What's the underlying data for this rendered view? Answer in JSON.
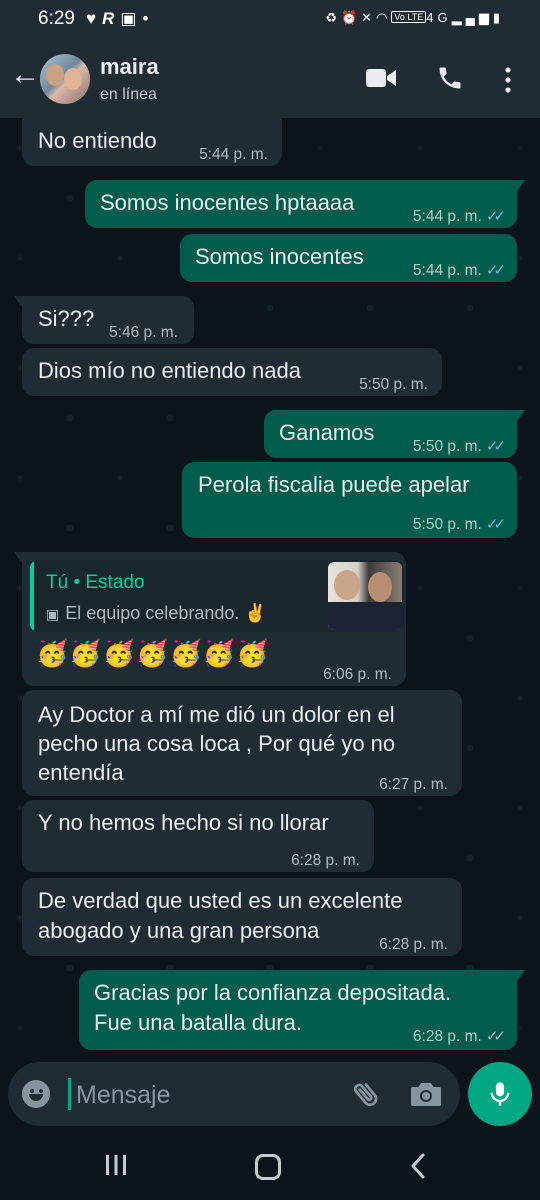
{
  "status_bar": {
    "time": "6:29",
    "left_icons": [
      "heart-icon",
      "r-app-icon",
      "gallery-icon",
      "dot-icon"
    ],
    "right_icons": [
      "battery-saver-icon",
      "alarm-icon",
      "mute-icon",
      "wifi-icon",
      "volte-icon",
      "signal-icon",
      "battery-icon"
    ],
    "network_badge": "VoLTE 4G",
    "network_type": "4G"
  },
  "header": {
    "contact_name": "maira",
    "contact_status": "en línea",
    "icons": [
      "back-arrow-icon",
      "video-call-icon",
      "voice-call-icon",
      "more-options-icon"
    ]
  },
  "messages": [
    {
      "direction": "in",
      "text": "No entiendo",
      "time": "5:44 p. m."
    },
    {
      "direction": "out",
      "text": "Somos inocentes hptaaaa",
      "time": "5:44 p. m.",
      "status": "read"
    },
    {
      "direction": "out",
      "text": "Somos inocentes",
      "time": "5:44 p. m.",
      "status": "read"
    },
    {
      "direction": "in",
      "text": "Si???",
      "time": "5:46 p. m."
    },
    {
      "direction": "in",
      "text": "Dios mío no entiendo nada",
      "time": "5:50 p. m."
    },
    {
      "direction": "out",
      "text": "Ganamos",
      "time": "5:50 p. m.",
      "status": "read"
    },
    {
      "direction": "out",
      "text": "Perola fiscalia puede apelar",
      "time": "5:50 p. m.",
      "status": "read"
    },
    {
      "direction": "in",
      "reply_author": "Tú • Estado",
      "reply_text": "El equipo celebrando. ✌️",
      "text": "🥳🥳🥳🥳🥳🥳🥳",
      "time": "6:06 p. m."
    },
    {
      "direction": "in",
      "lines": [
        "Ay Doctor a mí me dió un dolor en el",
        "pecho una cosa loca , Por qué yo no",
        "entendía"
      ],
      "time": "6:27 p. m."
    },
    {
      "direction": "in",
      "text": "Y no hemos hecho si no llorar",
      "time": "6:28 p. m."
    },
    {
      "direction": "in",
      "lines": [
        "De verdad que usted es un excelente",
        "abogado y una gran persona"
      ],
      "time": "6:28 p. m."
    },
    {
      "direction": "out",
      "lines": [
        "Gracias por la confianza depositada.",
        "Fue una batalla dura."
      ],
      "time": "6:28 p. m.",
      "status": "delivered"
    }
  ],
  "input": {
    "placeholder": "Mensaje",
    "icons": [
      "emoji-icon",
      "attach-icon",
      "camera-icon",
      "mic-icon"
    ]
  },
  "nav": {
    "icons": [
      "recent-apps-icon",
      "home-icon",
      "back-icon"
    ]
  },
  "colors": {
    "background": "#0b141a",
    "header": "#1f2c34",
    "incoming_bubble": "#202c33",
    "outgoing_bubble": "#005c4b",
    "accent": "#00a884",
    "read_ticks": "#53bdeb"
  }
}
